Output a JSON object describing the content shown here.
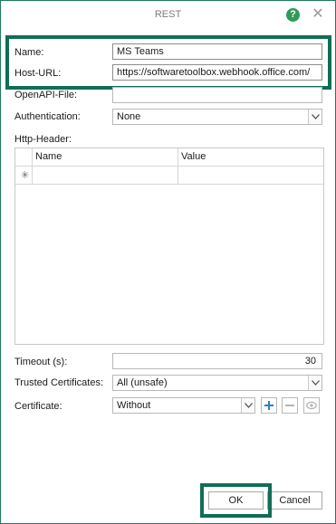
{
  "window": {
    "title": "REST"
  },
  "titlebar": {
    "help_icon": "?",
    "close_icon": "✕"
  },
  "form": {
    "name_label": "Name:",
    "name_value": "MS Teams",
    "host_url_label": "Host-URL:",
    "host_url_value": "https://softwaretoolbox.webhook.office.com/",
    "openapi_label": "OpenAPI-File:",
    "openapi_value": "",
    "authentication_label": "Authentication:",
    "authentication_value": "None",
    "http_header_label": "Http-Header:"
  },
  "header_grid": {
    "columns": [
      "Name",
      "Value"
    ],
    "new_row_icon": "✳"
  },
  "timeout": {
    "label": "Timeout (s):",
    "value": "30"
  },
  "trusted_certificates": {
    "label": "Trusted Certificates:",
    "value": "All (unsafe)"
  },
  "certificate": {
    "label": "Certificate:",
    "value": "Without"
  },
  "buttons": {
    "ok": "OK",
    "cancel": "Cancel"
  },
  "colors": {
    "highlight": "#0f6e56",
    "help_icon": "#2e9b5a",
    "add_icon": "#2f7fc2"
  }
}
